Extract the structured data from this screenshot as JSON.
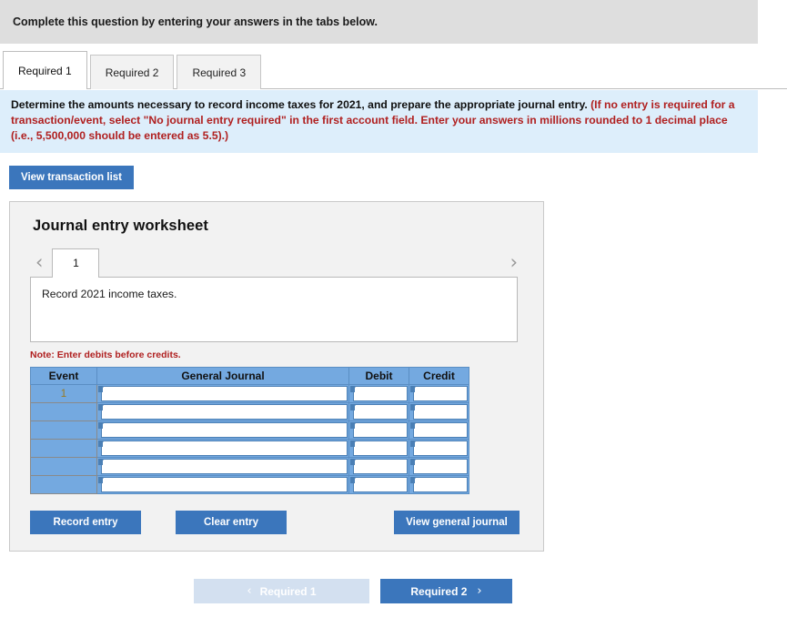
{
  "header": {
    "instruction": "Complete this question by entering your answers in the tabs below."
  },
  "tabs": [
    {
      "label": "Required 1",
      "active": true
    },
    {
      "label": "Required 2",
      "active": false
    },
    {
      "label": "Required 3",
      "active": false
    }
  ],
  "banner": {
    "text_black": "Determine the amounts necessary to record income taxes for 2021, and prepare the appropriate journal entry. ",
    "text_red": "(If no entry is required for a transaction/event, select \"No journal entry required\" in the first account field. Enter your answers in millions rounded to 1 decimal place (i.e., 5,500,000 should be entered as 5.5).)"
  },
  "toolbar": {
    "view_transaction_list_label": "View transaction list"
  },
  "worksheet": {
    "title": "Journal entry worksheet",
    "prev_chevron": "‹",
    "next_chevron": "›",
    "page_tab_label": "1",
    "description": "Record 2021 income taxes.",
    "note": "Note: Enter debits before credits.",
    "table": {
      "columns": [
        "Event",
        "General Journal",
        "Debit",
        "Credit"
      ],
      "rows": [
        {
          "event": "1",
          "general_journal": "",
          "debit": "",
          "credit": ""
        },
        {
          "event": "",
          "general_journal": "",
          "debit": "",
          "credit": ""
        },
        {
          "event": "",
          "general_journal": "",
          "debit": "",
          "credit": ""
        },
        {
          "event": "",
          "general_journal": "",
          "debit": "",
          "credit": ""
        },
        {
          "event": "",
          "general_journal": "",
          "debit": "",
          "credit": ""
        },
        {
          "event": "",
          "general_journal": "",
          "debit": "",
          "credit": ""
        }
      ]
    },
    "actions": {
      "record_entry_label": "Record entry",
      "clear_entry_label": "Clear entry",
      "view_general_journal_label": "View general journal"
    }
  },
  "bottom_nav": {
    "prev_label": "Required 1",
    "prev_arrow": "‹",
    "next_label": "Required 2",
    "next_arrow": "›"
  },
  "colors": {
    "header_gray": "#dedede",
    "banner_blue": "#ddeefb",
    "primary_blue": "#3b76bc",
    "table_header_blue": "#74a9e0",
    "disabled_blue": "#d3e0f0",
    "red_text": "#b02020"
  }
}
